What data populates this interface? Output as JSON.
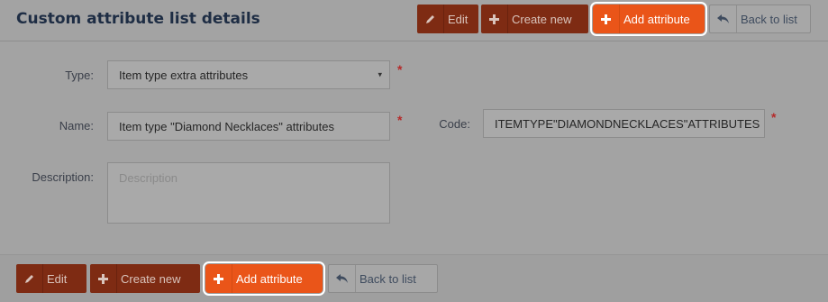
{
  "header": {
    "title": "Custom attribute list details"
  },
  "toolbar": {
    "edit_label": "Edit",
    "create_new_label": "Create new",
    "add_attribute_label": "Add attribute",
    "back_to_list_label": "Back to list"
  },
  "form": {
    "type": {
      "label": "Type:",
      "value": "Item type extra attributes",
      "arrow": "▾"
    },
    "name": {
      "label": "Name:",
      "value": "Item type \"Diamond Necklaces\" attributes"
    },
    "code": {
      "label": "Code:",
      "value": "ITEMTYPE\"DIAMONDNECKLACES\"ATTRIBUTES"
    },
    "description": {
      "label": "Description:",
      "placeholder": "Description"
    },
    "required_mark": "*"
  },
  "icons": {
    "edit": "pencil-icon",
    "create": "plus-icon",
    "add": "plus-icon",
    "back": "reply-arrow-icon"
  },
  "colors": {
    "accent": "#ea5519",
    "dark_accent": "#7e2b13",
    "title": "#1e2d44",
    "required": "#b52a2a"
  }
}
